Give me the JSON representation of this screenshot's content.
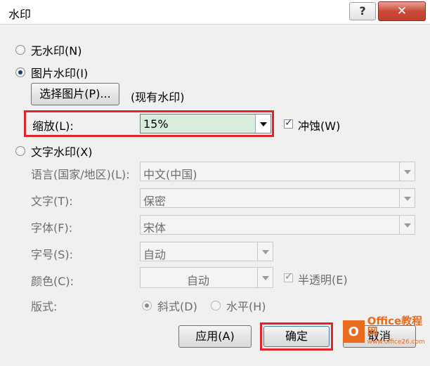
{
  "window": {
    "title": "水印",
    "help_label": "?",
    "close_label": "✕"
  },
  "options": {
    "no_watermark": "无水印(N)",
    "picture_watermark": "图片水印(I)",
    "text_watermark": "文字水印(X)"
  },
  "picture": {
    "select_button": "选择图片(P)...",
    "existing_note": "(现有水印)",
    "scale_label": "缩放(L):",
    "scale_value": "15%",
    "washout_label": "冲蚀(W)",
    "washout_checked": true
  },
  "text": {
    "language_label": "语言(国家/地区)(L):",
    "language_value": "中文(中国)",
    "text_label": "文字(T):",
    "text_value": "保密",
    "font_label": "字体(F):",
    "font_value": "宋体",
    "size_label": "字号(S):",
    "size_value": "自动",
    "color_label": "颜色(C):",
    "color_value": "自动",
    "semitransparent_label": "半透明(E)",
    "layout_label": "版式:",
    "diagonal_label": "斜式(D)",
    "horizontal_label": "水平(H)"
  },
  "buttons": {
    "apply": "应用(A)",
    "ok": "确定",
    "cancel": "取消"
  },
  "logo": {
    "main": "Office教程网",
    "sub": "www.office26.com",
    "glyph": "O"
  },
  "colors": {
    "highlight_box": "#e1262b",
    "scale_field_bg": "#d8eddb",
    "logo": "#e86c1f"
  }
}
